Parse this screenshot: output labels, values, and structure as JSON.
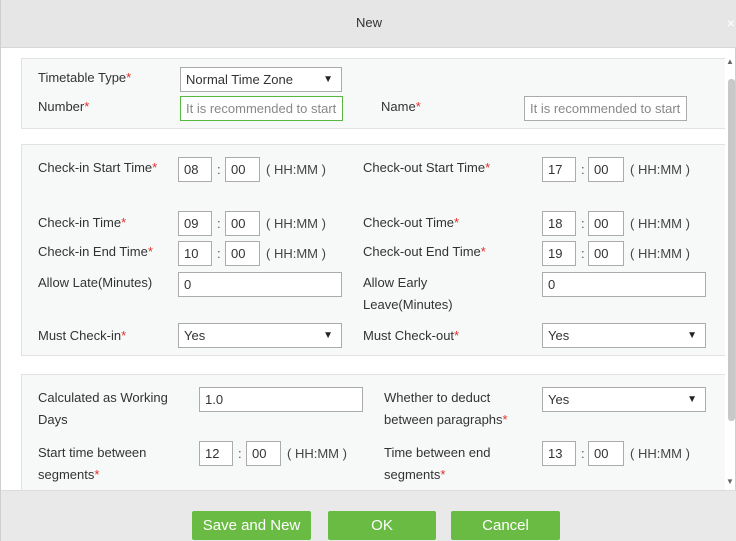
{
  "dialog": {
    "title": "New",
    "close_label": "×"
  },
  "basic": {
    "timetable_type_label": "Timetable Type",
    "timetable_type_value": "Normal Time Zone",
    "number_label": "Number",
    "number_placeholder": "It is recommended to start",
    "name_label": "Name",
    "name_placeholder": "It is recommended to start"
  },
  "times": {
    "checkin_start_label": "Check-in Start Time",
    "checkin_start_hh": "08",
    "checkin_start_mm": "00",
    "checkout_start_label": "Check-out Start Time",
    "checkout_start_hh": "17",
    "checkout_start_mm": "00",
    "checkin_time_label": "Check-in Time",
    "checkin_time_hh": "09",
    "checkin_time_mm": "00",
    "checkout_time_label": "Check-out Time",
    "checkout_time_hh": "18",
    "checkout_time_mm": "00",
    "checkin_end_label": "Check-in End Time",
    "checkin_end_hh": "10",
    "checkin_end_mm": "00",
    "checkout_end_label": "Check-out End Time",
    "checkout_end_hh": "19",
    "checkout_end_mm": "00",
    "allow_late_label": "Allow Late(Minutes)",
    "allow_late_value": "0",
    "allow_early_label": "Allow Early Leave(Minutes)",
    "allow_early_value": "0",
    "must_checkin_label": "Must Check-in",
    "must_checkin_value": "Yes",
    "must_checkout_label": "Must Check-out",
    "must_checkout_value": "Yes",
    "format": "( HH:MM )",
    "colon": ":",
    "required_mark": "*"
  },
  "working": {
    "working_days_label": "Calculated as Working Days",
    "working_days_value": "1.0",
    "deduct_label": "Whether to deduct between paragraphs",
    "deduct_value": "Yes",
    "seg_start_label": "Start time between segments",
    "seg_start_hh": "12",
    "seg_start_mm": "00",
    "seg_end_label": "Time between end segments",
    "seg_end_hh": "13",
    "seg_end_mm": "00"
  },
  "footer": {
    "save_new": "Save and New",
    "ok": "OK",
    "cancel": "Cancel"
  },
  "colors": {
    "accent": "#69bb44",
    "required": "#e0302c",
    "panel": "#f7f8f8"
  }
}
